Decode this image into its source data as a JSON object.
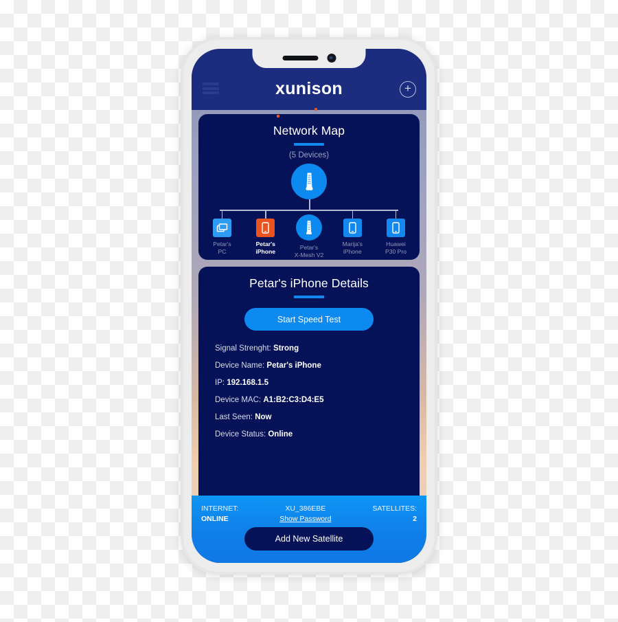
{
  "header": {
    "menu_icon": "hamburger-menu-icon",
    "brand": "unison",
    "brand_prefix": "x",
    "add_icon": "plus-circle-icon"
  },
  "network_map": {
    "title": "Network Map",
    "device_count": "(5 Devices)",
    "root": {
      "label": "router",
      "icon": "router-tower-icon"
    },
    "devices": [
      {
        "label_line1": "Petar's",
        "label_line2": "PC",
        "icon": "desktop-pc-icon",
        "style": "lblue",
        "active": false
      },
      {
        "label_line1": "Petar's",
        "label_line2": "iPhone",
        "icon": "smartphone-icon",
        "style": "orange",
        "active": true
      },
      {
        "label_line1": "Petar's",
        "label_line2": "X-Mesh V2",
        "icon": "router-tower-icon",
        "style": "circle",
        "active": false
      },
      {
        "label_line1": "Marija's",
        "label_line2": "iPhone",
        "icon": "smartphone-icon",
        "style": "blue",
        "active": false
      },
      {
        "label_line1": "Huawei",
        "label_line2": "P30 Pro",
        "icon": "smartphone-icon",
        "style": "blue",
        "active": false
      }
    ]
  },
  "details": {
    "title": "Petar's iPhone Details",
    "speed_test_label": "Start Speed Test",
    "rows": [
      {
        "label": "Signal Strenght:",
        "value": "Strong"
      },
      {
        "label": "Device Name:",
        "value": "Petar's iPhone"
      },
      {
        "label": "IP:",
        "value": "192.168.1.5"
      },
      {
        "label": "Device MAC:",
        "value": "A1:B2:C3:D4:E5"
      },
      {
        "label": "Last Seen:",
        "value": "Now"
      },
      {
        "label": "Device Status:",
        "value": "Online"
      }
    ]
  },
  "bottom_bar": {
    "internet_label": "INTERNET:",
    "internet_status": "ONLINE",
    "ssid": "XU_386EBE",
    "show_password": "Show Password",
    "satellites_label": "SATELLITES:",
    "satellites_count": "2",
    "add_satellite_label": "Add New Satellite"
  },
  "colors": {
    "header_navy": "#1c2c7f",
    "card_navy": "#061257",
    "accent_blue": "#1389f0",
    "bright_blue": "#0d8af0",
    "orange": "#e8531f",
    "bottom_bar_blue": "#0f7fe8",
    "phone_frame": "#e6e6e6"
  }
}
